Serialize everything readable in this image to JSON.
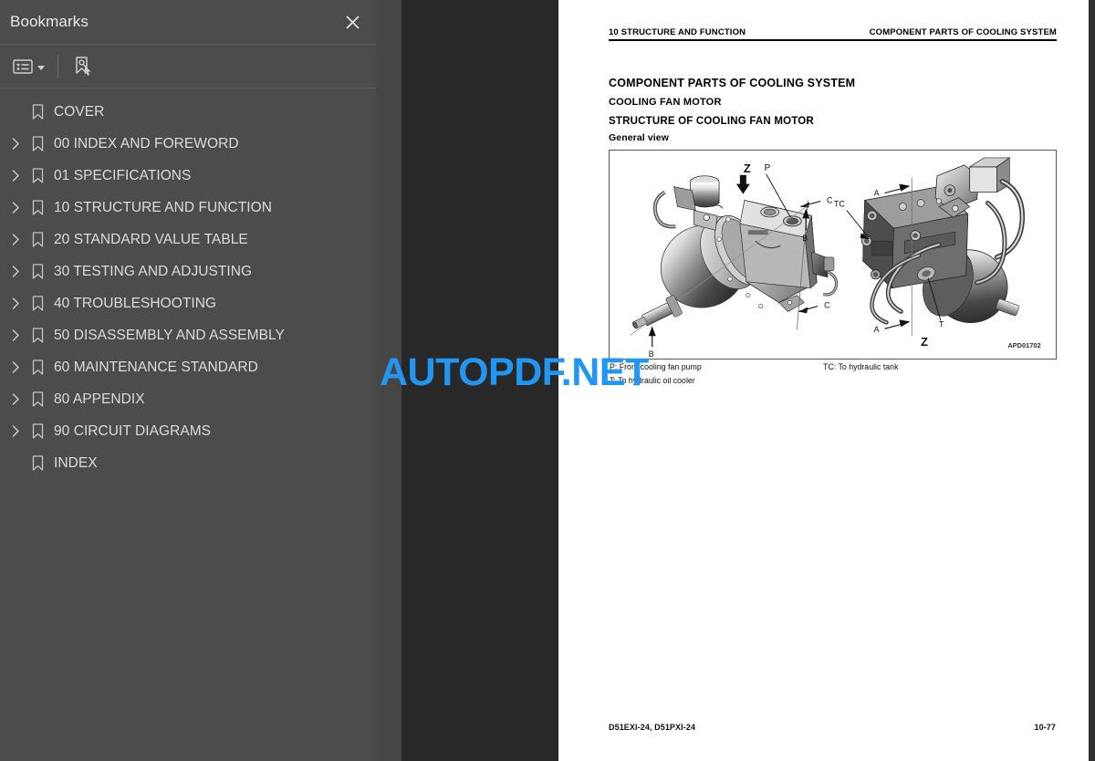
{
  "app": {
    "viewer_type": "pdf-reader"
  },
  "sidebar": {
    "title": "Bookmarks",
    "close_icon": "close-icon",
    "toolbar": {
      "list_options_icon": "list-options-icon",
      "caret_icon": "chevron-down-icon",
      "new_bookmark_icon": "new-bookmark-icon"
    },
    "items": [
      {
        "label": "COVER",
        "expandable": false
      },
      {
        "label": "00 INDEX AND FOREWORD",
        "expandable": true
      },
      {
        "label": "01 SPECIFICATIONS",
        "expandable": true
      },
      {
        "label": "10 STRUCTURE AND FUNCTION",
        "expandable": true
      },
      {
        "label": "20 STANDARD VALUE TABLE",
        "expandable": true
      },
      {
        "label": "30 TESTING AND ADJUSTING",
        "expandable": true
      },
      {
        "label": "40 TROUBLESHOOTING",
        "expandable": true
      },
      {
        "label": "50 DISASSEMBLY AND ASSEMBLY",
        "expandable": true
      },
      {
        "label": "60 MAINTENANCE STANDARD",
        "expandable": true
      },
      {
        "label": "80 APPENDIX",
        "expandable": true
      },
      {
        "label": "90 CIRCUIT DIAGRAMS",
        "expandable": true
      },
      {
        "label": "INDEX",
        "expandable": false
      }
    ]
  },
  "page": {
    "running_header_left": "10 STRUCTURE AND FUNCTION",
    "running_header_right": "COMPONENT PARTS OF COOLING SYSTEM",
    "title_1": "COMPONENT PARTS OF COOLING SYSTEM",
    "title_2": "COOLING FAN MOTOR",
    "title_3": "STRUCTURE OF COOLING FAN MOTOR",
    "title_4": "General view",
    "figure": {
      "id_label": "APD01702",
      "callouts_left": [
        "Z",
        "P",
        "C",
        "B",
        "B",
        "C"
      ],
      "callouts_right": [
        "TC",
        "A",
        "A",
        "T",
        "Z"
      ]
    },
    "captions": {
      "p": "P: From cooling fan pump",
      "t": "T: To hydraulic oil cooler",
      "tc": "TC: To hydraulic tank"
    },
    "footer_left": "D51EXI-24, D51PXI-24",
    "footer_right": "10-77"
  },
  "watermark": {
    "text": "AUTOPDF.NET",
    "color": "#2196f3"
  }
}
